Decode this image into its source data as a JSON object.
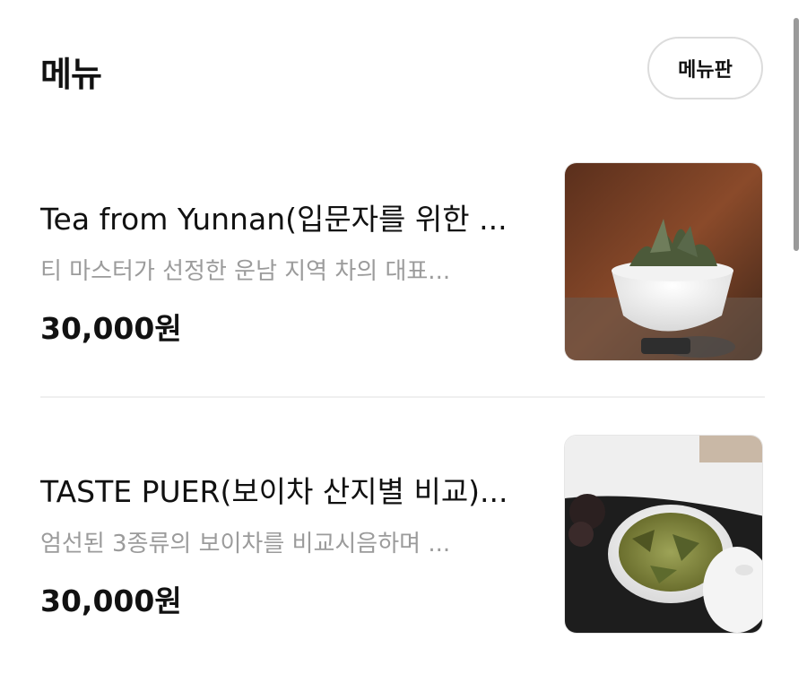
{
  "header": {
    "title": "메뉴",
    "menu_board_label": "메뉴판"
  },
  "items": [
    {
      "name": "Tea from Yunnan(입문자를 위한 ...",
      "description": "티 마스터가 선정한 운남 지역 차의 대표...",
      "price": "30,000원"
    },
    {
      "name": "TASTE PUER(보이차 산지별 비교)...",
      "description": "엄선된 3종류의 보이차를 비교시음하며 ...",
      "price": "30,000원"
    }
  ],
  "icons": [
    "tea-cup-photo",
    "gaiwan-photo"
  ]
}
